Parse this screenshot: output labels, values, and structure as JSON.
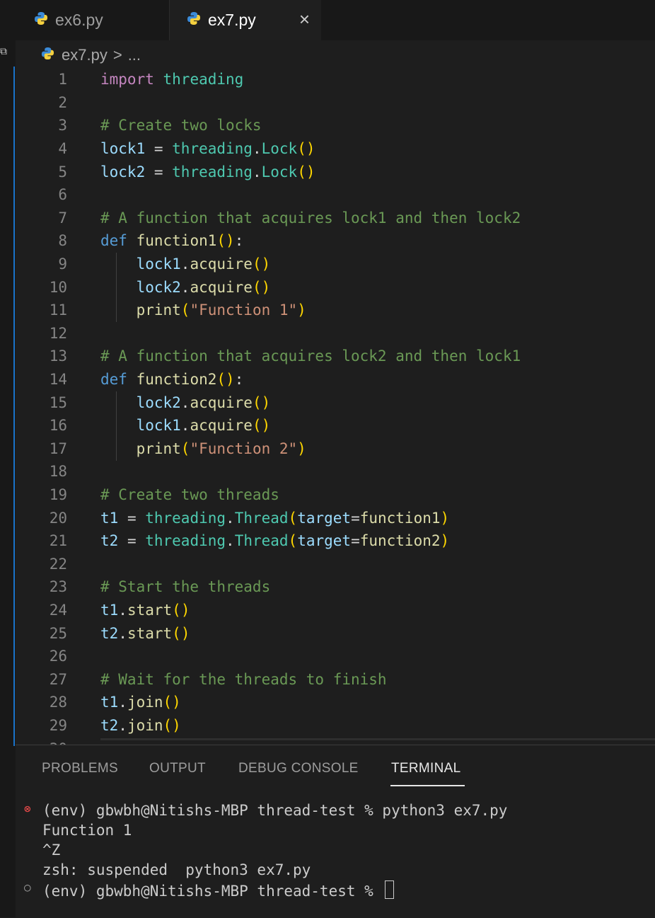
{
  "tabs": [
    {
      "label": "ex6.py",
      "active": false
    },
    {
      "label": "ex7.py",
      "active": true
    }
  ],
  "tab_close_icon": "×",
  "breadcrumb": {
    "file": "ex7.py",
    "separator": ">",
    "rest": "..."
  },
  "editor": {
    "lines": [
      [
        {
          "t": "import",
          "c": "kw"
        },
        {
          "t": " "
        },
        {
          "t": "threading",
          "c": "mod"
        }
      ],
      [],
      [
        {
          "t": "# Create two locks",
          "c": "cm"
        }
      ],
      [
        {
          "t": "lock1",
          "c": "var"
        },
        {
          "t": " = ",
          "c": "op"
        },
        {
          "t": "threading",
          "c": "mod"
        },
        {
          "t": ".",
          "c": "op"
        },
        {
          "t": "Lock",
          "c": "mod"
        },
        {
          "t": "()",
          "c": "br"
        }
      ],
      [
        {
          "t": "lock2",
          "c": "var"
        },
        {
          "t": " = ",
          "c": "op"
        },
        {
          "t": "threading",
          "c": "mod"
        },
        {
          "t": ".",
          "c": "op"
        },
        {
          "t": "Lock",
          "c": "mod"
        },
        {
          "t": "()",
          "c": "br"
        }
      ],
      [],
      [
        {
          "t": "# A function that acquires lock1 and then lock2",
          "c": "cm"
        }
      ],
      [
        {
          "t": "def",
          "c": "kw2"
        },
        {
          "t": " "
        },
        {
          "t": "function1",
          "c": "fn"
        },
        {
          "t": "()",
          "c": "br"
        },
        {
          "t": ":",
          "c": "op"
        }
      ],
      [
        {
          "t": "    "
        },
        {
          "t": "lock1",
          "c": "var"
        },
        {
          "t": ".",
          "c": "op"
        },
        {
          "t": "acquire",
          "c": "fn"
        },
        {
          "t": "()",
          "c": "br"
        }
      ],
      [
        {
          "t": "    "
        },
        {
          "t": "lock2",
          "c": "var"
        },
        {
          "t": ".",
          "c": "op"
        },
        {
          "t": "acquire",
          "c": "fn"
        },
        {
          "t": "()",
          "c": "br"
        }
      ],
      [
        {
          "t": "    "
        },
        {
          "t": "print",
          "c": "fn"
        },
        {
          "t": "(",
          "c": "br"
        },
        {
          "t": "\"Function 1\"",
          "c": "str"
        },
        {
          "t": ")",
          "c": "br"
        }
      ],
      [],
      [
        {
          "t": "# A function that acquires lock2 and then lock1",
          "c": "cm"
        }
      ],
      [
        {
          "t": "def",
          "c": "kw2"
        },
        {
          "t": " "
        },
        {
          "t": "function2",
          "c": "fn"
        },
        {
          "t": "()",
          "c": "br"
        },
        {
          "t": ":",
          "c": "op"
        }
      ],
      [
        {
          "t": "    "
        },
        {
          "t": "lock2",
          "c": "var"
        },
        {
          "t": ".",
          "c": "op"
        },
        {
          "t": "acquire",
          "c": "fn"
        },
        {
          "t": "()",
          "c": "br"
        }
      ],
      [
        {
          "t": "    "
        },
        {
          "t": "lock1",
          "c": "var"
        },
        {
          "t": ".",
          "c": "op"
        },
        {
          "t": "acquire",
          "c": "fn"
        },
        {
          "t": "()",
          "c": "br"
        }
      ],
      [
        {
          "t": "    "
        },
        {
          "t": "print",
          "c": "fn"
        },
        {
          "t": "(",
          "c": "br"
        },
        {
          "t": "\"Function 2\"",
          "c": "str"
        },
        {
          "t": ")",
          "c": "br"
        }
      ],
      [],
      [
        {
          "t": "# Create two threads",
          "c": "cm"
        }
      ],
      [
        {
          "t": "t1",
          "c": "var"
        },
        {
          "t": " = ",
          "c": "op"
        },
        {
          "t": "threading",
          "c": "mod"
        },
        {
          "t": ".",
          "c": "op"
        },
        {
          "t": "Thread",
          "c": "mod"
        },
        {
          "t": "(",
          "c": "br"
        },
        {
          "t": "target",
          "c": "var"
        },
        {
          "t": "=",
          "c": "op"
        },
        {
          "t": "function1",
          "c": "fn"
        },
        {
          "t": ")",
          "c": "br"
        }
      ],
      [
        {
          "t": "t2",
          "c": "var"
        },
        {
          "t": " = ",
          "c": "op"
        },
        {
          "t": "threading",
          "c": "mod"
        },
        {
          "t": ".",
          "c": "op"
        },
        {
          "t": "Thread",
          "c": "mod"
        },
        {
          "t": "(",
          "c": "br"
        },
        {
          "t": "target",
          "c": "var"
        },
        {
          "t": "=",
          "c": "op"
        },
        {
          "t": "function2",
          "c": "fn"
        },
        {
          "t": ")",
          "c": "br"
        }
      ],
      [],
      [
        {
          "t": "# Start the threads",
          "c": "cm"
        }
      ],
      [
        {
          "t": "t1",
          "c": "var"
        },
        {
          "t": ".",
          "c": "op"
        },
        {
          "t": "start",
          "c": "fn"
        },
        {
          "t": "()",
          "c": "br"
        }
      ],
      [
        {
          "t": "t2",
          "c": "var"
        },
        {
          "t": ".",
          "c": "op"
        },
        {
          "t": "start",
          "c": "fn"
        },
        {
          "t": "()",
          "c": "br"
        }
      ],
      [],
      [
        {
          "t": "# Wait for the threads to finish",
          "c": "cm"
        }
      ],
      [
        {
          "t": "t1",
          "c": "var"
        },
        {
          "t": ".",
          "c": "op"
        },
        {
          "t": "join",
          "c": "fn"
        },
        {
          "t": "()",
          "c": "br"
        }
      ],
      [
        {
          "t": "t2",
          "c": "var"
        },
        {
          "t": ".",
          "c": "op"
        },
        {
          "t": "join",
          "c": "fn"
        },
        {
          "t": "()",
          "c": "br"
        }
      ],
      []
    ]
  },
  "panel": {
    "tabs": [
      "PROBLEMS",
      "OUTPUT",
      "DEBUG CONSOLE",
      "TERMINAL"
    ],
    "active_tab": "TERMINAL",
    "terminal_lines": [
      {
        "icon": "⊗",
        "icon_color": "#f14c4c",
        "text": "(env) gbwbh@Nitishs-MBP thread-test % python3 ex7.py"
      },
      {
        "icon": "",
        "text": "Function 1"
      },
      {
        "icon": "",
        "text": "^Z"
      },
      {
        "icon": "",
        "text": "zsh: suspended  python3 ex7.py"
      },
      {
        "icon": "○",
        "icon_color": "#9d9d9d",
        "text": "(env) gbwbh@Nitishs-MBP thread-test % ",
        "cursor": true
      }
    ]
  },
  "colors": {
    "accent": "#1a73c9",
    "background": "#1e1e1e",
    "python_icon_blue": "#3b8bd8",
    "python_icon_yellow": "#f4d03f"
  }
}
